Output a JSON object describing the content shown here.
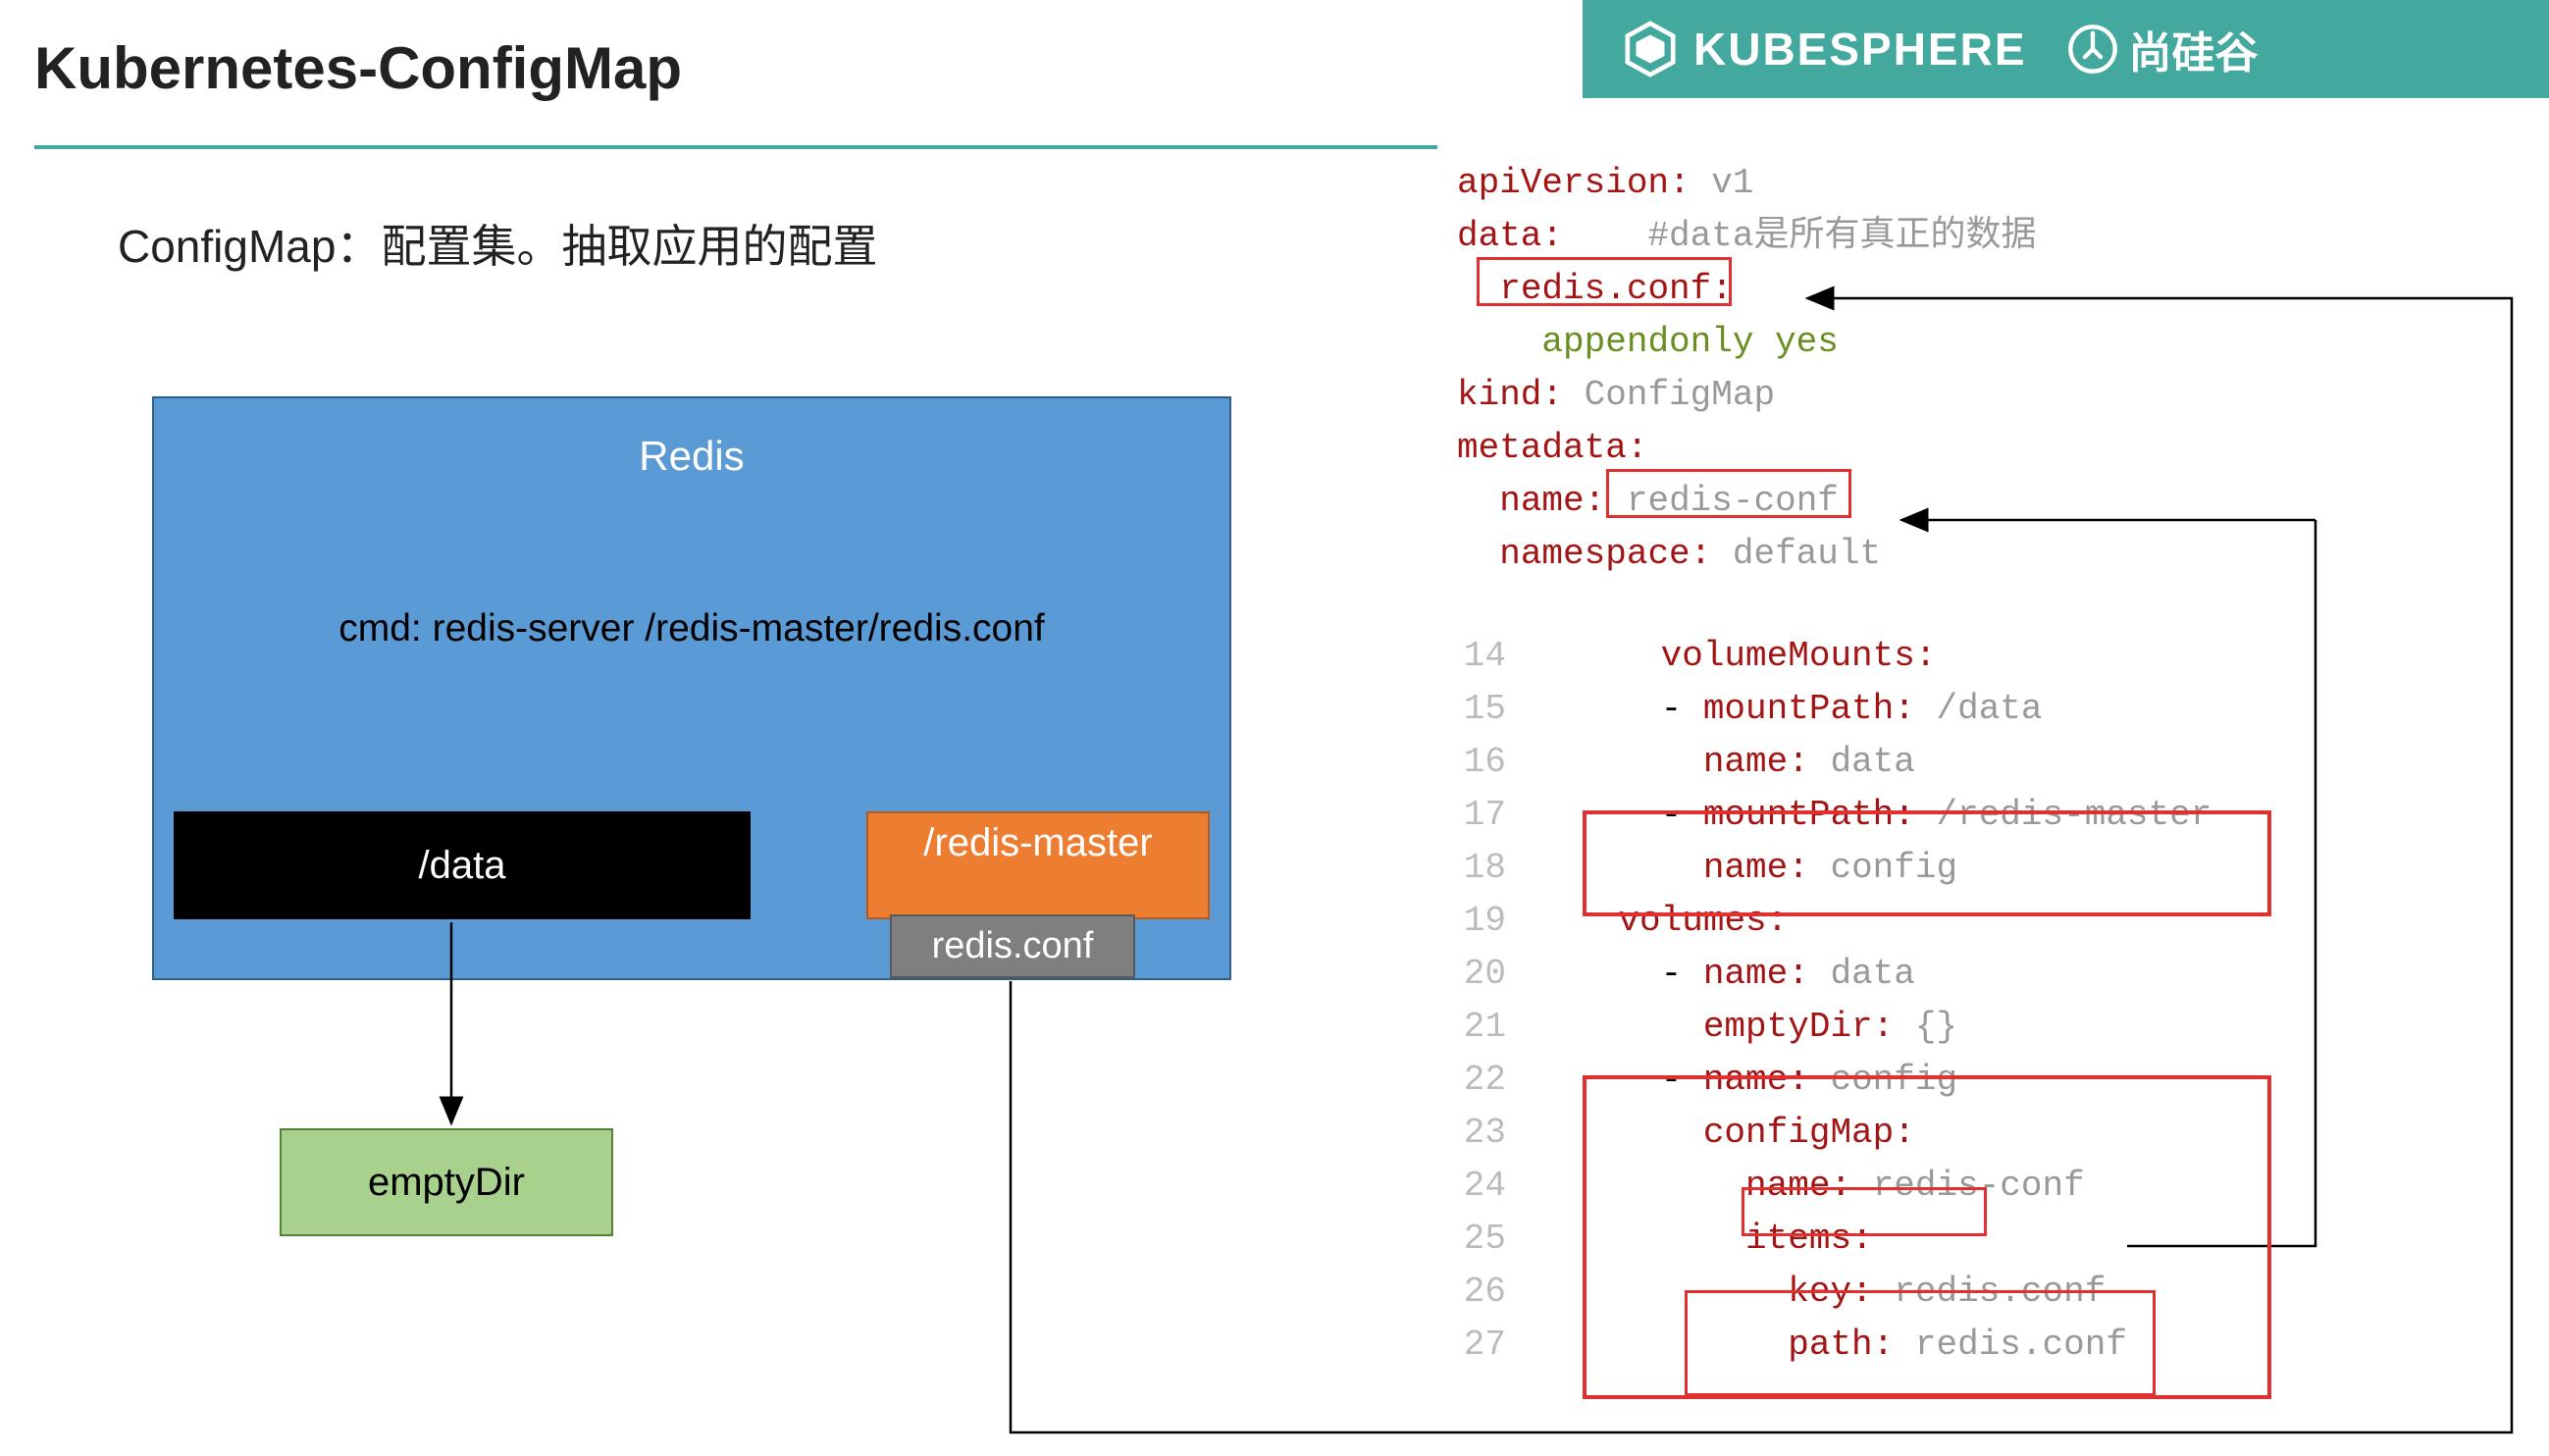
{
  "header": {
    "logo1": "KUBESPHERE",
    "logo2": "尚硅谷"
  },
  "title": "Kubernetes-ConfigMap",
  "subtitle": "ConfigMap：配置集。抽取应用的配置",
  "diagram": {
    "redis_title": "Redis",
    "redis_cmd": "cmd:   redis-server  /redis-master/redis.conf",
    "data_box": "/data",
    "redis_master_box": "/redis-master",
    "redis_conf_box": "redis.conf",
    "emptydir_box": "emptyDir"
  },
  "yaml": {
    "l1_k": "apiVersion",
    "l1_v": "v1",
    "l2_k": "data",
    "l2_comment": "#data是所有真正的数据",
    "l3_k": "redis.conf",
    "l4": "appendonly yes",
    "l5_k": "kind",
    "l5_v": "ConfigMap",
    "l6_k": "metadata",
    "l7_k": "name",
    "l7_v": "redis-conf",
    "l8_k": "namespace",
    "l8_v": "default",
    "lines": [
      {
        "num": "14",
        "key": "volumeMounts",
        "val": "",
        "indent": 3
      },
      {
        "num": "15",
        "dash": true,
        "key": "mountPath",
        "val": "/data",
        "indent": 3
      },
      {
        "num": "16",
        "key": "name",
        "val": "data",
        "indent": 4
      },
      {
        "num": "17",
        "dash": true,
        "key": "mountPath",
        "val": "/redis-master",
        "indent": 3
      },
      {
        "num": "18",
        "key": "name",
        "val": "config",
        "indent": 4
      },
      {
        "num": "19",
        "key": "volumes",
        "val": "",
        "indent": 2
      },
      {
        "num": "20",
        "dash": true,
        "key": "name",
        "val": "data",
        "indent": 3
      },
      {
        "num": "21",
        "key": "emptyDir",
        "val": "{}",
        "indent": 4
      },
      {
        "num": "22",
        "dash": true,
        "key": "name",
        "val": "config",
        "indent": 3
      },
      {
        "num": "23",
        "key": "configMap",
        "val": "",
        "indent": 4
      },
      {
        "num": "24",
        "key": "name",
        "val": "redis-conf",
        "indent": 5
      },
      {
        "num": "25",
        "key": "items",
        "val": "",
        "indent": 5
      },
      {
        "num": "26",
        "dash": true,
        "key": "key",
        "val": "redis.conf",
        "indent": 5
      },
      {
        "num": "27",
        "key": "path",
        "val": "redis.conf",
        "indent": 6
      }
    ]
  }
}
